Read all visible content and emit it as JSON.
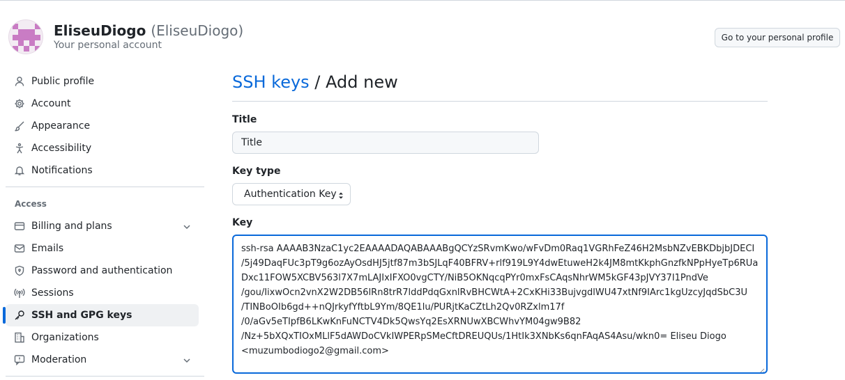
{
  "header": {
    "display_name": "EliseuDiogo",
    "login": "(EliseuDiogo)",
    "subtitle": "Your personal account",
    "profile_button": "Go to your personal profile"
  },
  "sidebar": {
    "items": [
      {
        "label": "Public profile",
        "icon": "person-icon"
      },
      {
        "label": "Account",
        "icon": "gear-icon"
      },
      {
        "label": "Appearance",
        "icon": "paintbrush-icon"
      },
      {
        "label": "Accessibility",
        "icon": "accessibility-icon"
      },
      {
        "label": "Notifications",
        "icon": "bell-icon"
      }
    ],
    "access_title": "Access",
    "access_items": [
      {
        "label": "Billing and plans",
        "icon": "credit-card-icon"
      },
      {
        "label": "Emails",
        "icon": "mail-icon"
      },
      {
        "label": "Password and authentication",
        "icon": "shield-lock-icon"
      },
      {
        "label": "Sessions",
        "icon": "broadcast-icon"
      },
      {
        "label": "SSH and GPG keys",
        "icon": "key-icon",
        "active": true
      },
      {
        "label": "Organizations",
        "icon": "organization-icon"
      },
      {
        "label": "Moderation",
        "icon": "report-icon"
      }
    ]
  },
  "main": {
    "breadcrumb_link": "SSH keys",
    "breadcrumb_rest": " / Add new",
    "title_label": "Title",
    "title_placeholder": "Title",
    "key_type_label": "Key type",
    "key_type_value": "Authentication Key",
    "key_label": "Key",
    "key_value": "ssh-rsa AAAAB3NzaC1yc2EAAAADAQABAAABgQCYzSRvmKwo/wFvDm0Raq1VGRhFeZ46H2MsbNZvEBKDbjbJDECI\n/5j49DaqFUc3pT9g6ozAyOsdHJ5jtf87m3bSJLqF40BFRV+rlf919L9Y4dwEtuweH2k4JM8mtKkphGnzfkNPpHyeTp6RUaDxc11FOW5XCBV563l7X7mLAJIxIFXO0vgCTY/NiB5OKNqcqPYr0mxFsCAqsNhrWM5kGF43pJVY37I1PndVe\n/gou/IixwOcn2vnX2W2DB56lRn8trR7lddPdqGxnlRvBHCWtA+2CxKHi33BujvgdlWU47xtNf9IArc1kgUzcyJqdSbC3U\n/TINBoOIb6gd++nQJrkyfYftbL9Ym/8QE1lu/PURjtKaCZtLh2Qv0RZxlm17f\n/0/aGv5eTIpfB6LKwKnFuNCTV4Dk5QwsYq2EsXRNUwXBCWhvYM04gw9B82\n/Nz+5bXQxTIOxMLlF5dAWDoCVkIWPERpSMeCftDREUQUs/1HtIk3XNbKs6qnFAqAS4Asu/wkn0= Eliseu Diogo\n<muzumbodiogo2@gmail.com>"
  },
  "colors": {
    "link": "#0969da",
    "active_bar": "#0969da",
    "border": "#d0d7de"
  }
}
